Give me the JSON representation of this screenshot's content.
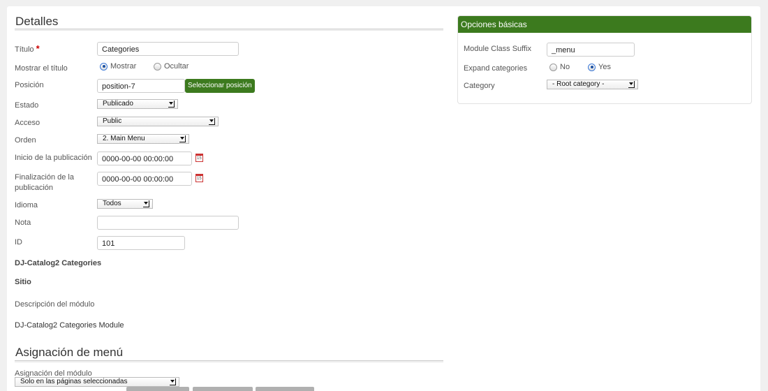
{
  "details": {
    "title": "Detalles",
    "fields": {
      "titulo": {
        "label": "Título",
        "required_mark": "*",
        "value": "Categories"
      },
      "mostrar_titulo": {
        "label": "Mostrar el título",
        "options": [
          "Mostrar",
          "Ocultar"
        ],
        "selected": "Mostrar"
      },
      "posicion": {
        "label": "Posición",
        "value": "position-7",
        "button": "Seleccionar posición"
      },
      "estado": {
        "label": "Estado",
        "value": "Publicado"
      },
      "acceso": {
        "label": "Acceso",
        "value": "Public"
      },
      "orden": {
        "label": "Orden",
        "value": "2. Main Menu"
      },
      "inicio": {
        "label": "Inicio de la publicación",
        "value": "0000-00-00 00:00:00"
      },
      "finalizacion": {
        "label_line1": "Finalización de la",
        "label_line2": "publicación",
        "value": "0000-00-00 00:00:00"
      },
      "idioma": {
        "label": "Idioma",
        "value": "Todos"
      },
      "nota": {
        "label": "Nota",
        "value": ""
      },
      "id": {
        "label": "ID",
        "value": "101"
      }
    },
    "module_name": "DJ-Catalog2 Categories",
    "site_label": "Sitio",
    "description_label": "Descripción del módulo",
    "description_value": "DJ-Catalog2 Categories Module"
  },
  "menu_assignment": {
    "title": "Asignación de menú",
    "label": "Asignación del módulo",
    "value": "Solo en las páginas seleccionadas"
  },
  "basic_options": {
    "title": "Opciones básicas",
    "module_class_suffix": {
      "label": "Module Class Suffix",
      "value": "_menu"
    },
    "expand_categories": {
      "label": "Expand categories",
      "options": [
        "No",
        "Yes"
      ],
      "selected": "Yes"
    },
    "category": {
      "label": "Category",
      "value": "- Root category -"
    }
  },
  "icons": {
    "calendar": "calendar-icon",
    "select_arrow": "dropdown-arrow-icon"
  },
  "colors": {
    "accent_green": "#3c7a1e",
    "required_red": "#cc0000"
  }
}
